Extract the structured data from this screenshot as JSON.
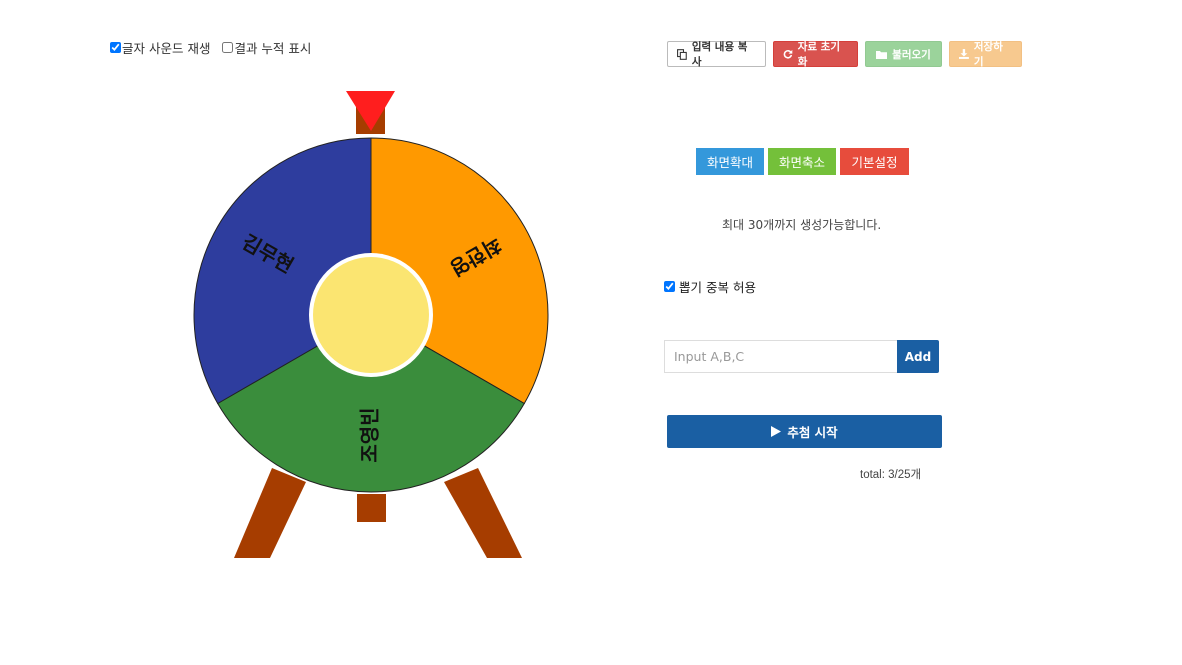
{
  "options": {
    "sound_label": "글자 사운드 재생",
    "sound_checked": true,
    "cumulative_label": "결과 누적 표시",
    "cumulative_checked": false
  },
  "toolbar": {
    "copy_label": "입력 내용 복사",
    "reset_label": "자료 초기화",
    "load_label": "불러오기",
    "save_label": "저장하기",
    "copy_icon": "copy-icon",
    "reset_icon": "refresh-icon",
    "load_icon": "folder-icon",
    "save_icon": "download-icon"
  },
  "view": {
    "zoom_in_label": "화면확대",
    "zoom_out_label": "화면축소",
    "basic_label": "기본설정"
  },
  "info": {
    "max_text": "최대 30개까지 생성가능합니다."
  },
  "allow_duplicates": {
    "label": "뽑기 중복 허용",
    "checked": true
  },
  "input": {
    "placeholder": "Input A,B,C",
    "value": "",
    "add_label": "Add"
  },
  "start": {
    "label": "추첨 시작",
    "icon": "play-icon"
  },
  "total_text": "total: 3/25개",
  "wheel": {
    "segments": [
      {
        "label": "최한영",
        "color": "#ff9900"
      },
      {
        "label": "조영빈",
        "color": "#3a8d3c"
      },
      {
        "label": "김무현",
        "color": "#2e3d9e"
      }
    ],
    "center_color": "#fbe571",
    "pointer_color": "#ff1e1e",
    "stand_color": "#a63d00"
  }
}
